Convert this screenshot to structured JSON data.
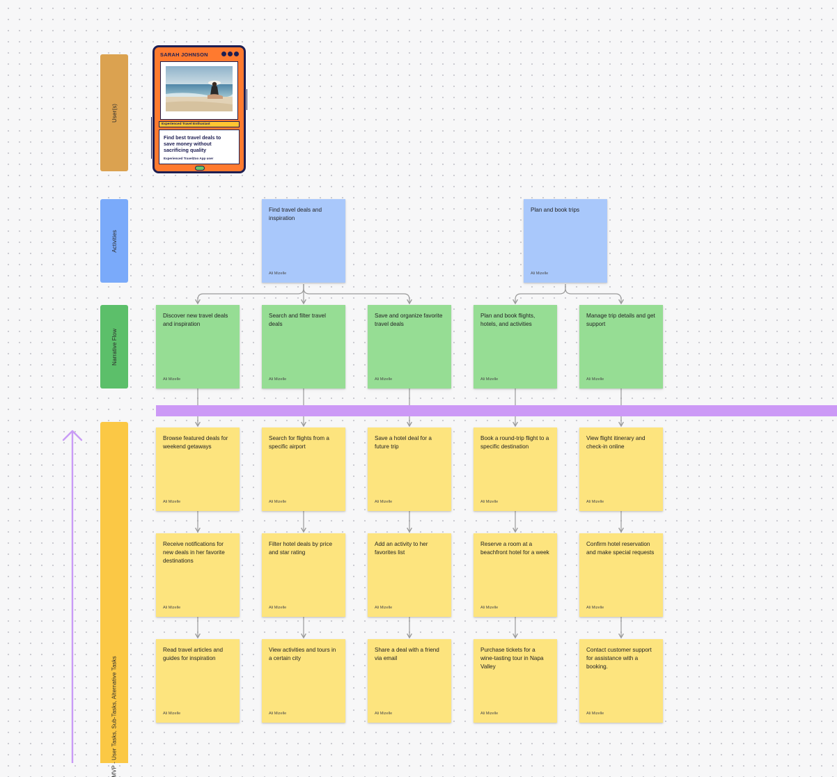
{
  "lanes": {
    "users": {
      "label": "User(s)",
      "color": "#dba250"
    },
    "activities": {
      "label": "Activities",
      "color": "#7aaafa"
    },
    "narrative": {
      "label": "Narrative Flow",
      "color": "#5cbf6a"
    },
    "mvp": {
      "label": "MVP - User Tasks, Sub-Tasks, Alternative Tasks",
      "color": "#fbc845"
    }
  },
  "persona": {
    "name": "SARAH JOHNSON",
    "role": "Experienced Travel Enthusiast",
    "goal": "Find best travel deals to save money without sacrificing quality",
    "subtitle": "Experienced TravelZoo App user"
  },
  "activities": [
    {
      "text": "Find travel deals and inspiration",
      "author": "Ali Mizelle"
    },
    {
      "text": "Plan and book trips",
      "author": "Ali Mizelle"
    }
  ],
  "narrative": [
    {
      "text": "Discover new travel deals and inspiration",
      "author": "Ali Mizelle"
    },
    {
      "text": "Search and filter travel deals",
      "author": "Ali Mizelle"
    },
    {
      "text": "Save and organize favorite travel deals",
      "author": "Ali Mizelle"
    },
    {
      "text": "Plan and book flights, hotels, and activities",
      "author": "Ali Mizelle"
    },
    {
      "text": "Manage trip details and get support",
      "author": "Ali Mizelle"
    }
  ],
  "tasks": [
    [
      {
        "text": "Browse featured deals for weekend getaways",
        "author": "Ali Mizelle"
      },
      {
        "text": "Search for flights from a specific airport",
        "author": "Ali Mizelle"
      },
      {
        "text": "Save a hotel deal for a future trip",
        "author": "Ali Mizelle"
      },
      {
        "text": "Book a round-trip flight to a specific destination",
        "author": "Ali Mizelle"
      },
      {
        "text": "View flight itinerary and check-in online",
        "author": "Ali Mizelle"
      }
    ],
    [
      {
        "text": "Receive notifications for new deals in her favorite destinations",
        "author": "Ali Mizelle"
      },
      {
        "text": "Filter hotel deals by price and star rating",
        "author": "Ali Mizelle"
      },
      {
        "text": "Add an activity to her favorites list",
        "author": "Ali Mizelle"
      },
      {
        "text": "Reserve a room at a beachfront hotel for a week",
        "author": "Ali Mizelle"
      },
      {
        "text": "Confirm hotel reservation and make special requests",
        "author": "Ali Mizelle"
      }
    ],
    [
      {
        "text": "Read travel articles and guides for inspiration",
        "author": "Ali Mizelle"
      },
      {
        "text": "View activities and tours in a certain city",
        "author": "Ali Mizelle"
      },
      {
        "text": "Share a deal with a friend via email",
        "author": "Ali Mizelle"
      },
      {
        "text": "Purchase tickets for a wine-tasting tour in Napa Valley",
        "author": "Ali Mizelle"
      },
      {
        "text": "Contact customer support for assistance with a booking.",
        "author": "Ali Mizelle"
      }
    ]
  ],
  "colors": {
    "activity_note": "#a9c8fb",
    "narrative_note": "#96dd94",
    "task_note": "#fde47e",
    "release_bar": "#cc99f6",
    "priority_arrow": "#c99bf6",
    "connector": "#9a9a9a"
  }
}
